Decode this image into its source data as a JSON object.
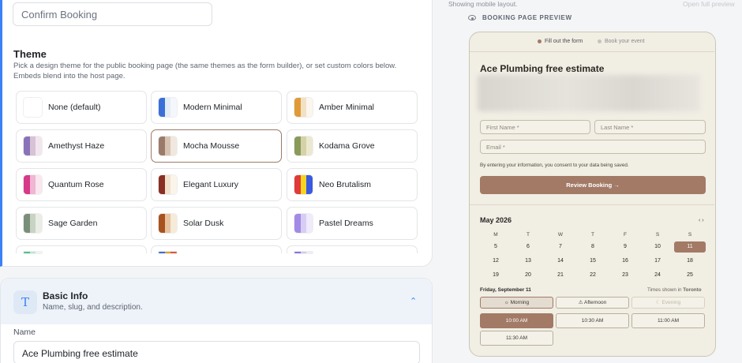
{
  "left": {
    "confirm_field_value": "Confirm Booking",
    "theme": {
      "title": "Theme",
      "description": "Pick a design theme for the public booking page (the same themes as the form builder), or set custom colors below. Embeds blend into the host page.",
      "selected": "Mocha Mousse",
      "options": [
        {
          "label": "None (default)",
          "colors": [
            "#ffffff"
          ]
        },
        {
          "label": "Modern Minimal",
          "colors": [
            "#3b6fd8",
            "#e4ecf8",
            "#f4f7fc"
          ]
        },
        {
          "label": "Amber Minimal",
          "colors": [
            "#e09a38",
            "#f3e1c4",
            "#fbf6ee"
          ]
        },
        {
          "label": "Amethyst Haze",
          "colors": [
            "#8a72b8",
            "#d8c2d6",
            "#f1e6ee"
          ]
        },
        {
          "label": "Mocha Mousse",
          "colors": [
            "#9a7b6a",
            "#d8c3b2",
            "#f0e8df"
          ]
        },
        {
          "label": "Kodama Grove",
          "colors": [
            "#8a9a5a",
            "#d6d2a8",
            "#ece8cf"
          ]
        },
        {
          "label": "Quantum Rose",
          "colors": [
            "#d63a8a",
            "#f0b6d3",
            "#fae6ef"
          ]
        },
        {
          "label": "Elegant Luxury",
          "colors": [
            "#8a2f24",
            "#f0e2cf",
            "#faf4ea"
          ]
        },
        {
          "label": "Neo Brutalism",
          "colors": [
            "#e03a3a",
            "#f5d51f",
            "#3a5ae0"
          ]
        },
        {
          "label": "Sage Garden",
          "colors": [
            "#7a8f7a",
            "#c8d3c4",
            "#e9ede6"
          ]
        },
        {
          "label": "Solar Dusk",
          "colors": [
            "#a8521f",
            "#e7c3a0",
            "#f6ead9"
          ]
        },
        {
          "label": "Pastel Dreams",
          "colors": [
            "#a28ae6",
            "#d7cdf4",
            "#efeafc"
          ]
        }
      ],
      "partial_row": [
        {
          "colors": [
            "#4ac58a",
            "#b8e7cf",
            "#eaf8f0"
          ]
        },
        {
          "colors": [
            "#3b6fd8",
            "#e0a030",
            "#e0543a"
          ]
        },
        {
          "colors": [
            "#8a72e0",
            "#d2c8f4",
            "#efeafc"
          ]
        }
      ]
    },
    "basic_info": {
      "title": "Basic Info",
      "subtitle": "Name, slug, and description.",
      "name_label": "Name",
      "name_value": "Ace Plumbing free estimate"
    }
  },
  "right": {
    "top_note": "Showing mobile layout.",
    "open_full": "Open full preview",
    "preview_heading": "BOOKING PAGE PREVIEW",
    "steps": {
      "step1": "Fill out the form",
      "step2": "Book your event"
    },
    "title": "Ace Plumbing free estimate",
    "first_name_placeholder": "First Name *",
    "last_name_placeholder": "Last Name *",
    "email_placeholder": "Email *",
    "consent": "By entering your information, you consent to your data being saved.",
    "review_button": "Review Booking →",
    "calendar": {
      "month": "May 2026",
      "nav": "‹ ›",
      "weekdays": [
        "M",
        "T",
        "W",
        "T",
        "F",
        "S",
        "S"
      ],
      "weeks": [
        [
          "5",
          "6",
          "7",
          "8",
          "9",
          "10",
          "11"
        ],
        [
          "12",
          "13",
          "14",
          "15",
          "16",
          "17",
          "18"
        ],
        [
          "19",
          "20",
          "21",
          "22",
          "23",
          "24",
          "25"
        ]
      ],
      "selected_day": "11"
    },
    "day_label": "Friday, September 11",
    "tz_prefix": "Times shown in",
    "tz_city": "Toronto",
    "periods": [
      "☼ Morning",
      "⚠ Afternoon",
      "☾ Evening"
    ],
    "slots": [
      "10:00 AM",
      "10:30 AM",
      "11:00 AM",
      "11:30 AM"
    ],
    "accent": "#a27a66"
  }
}
